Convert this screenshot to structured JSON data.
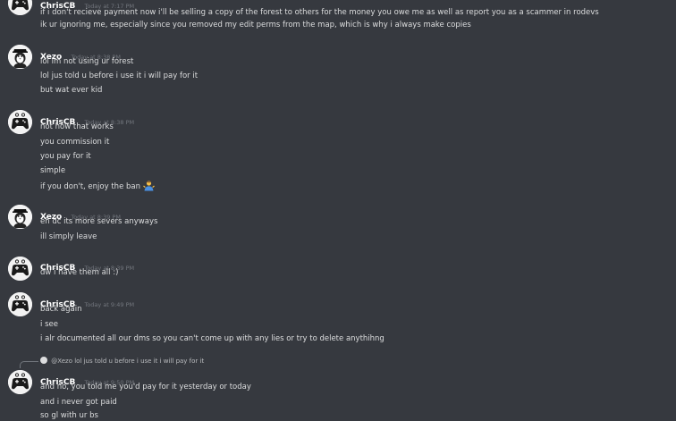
{
  "groups": [
    {
      "author": "ChrisCB",
      "timestamp": "Today at 7:17 PM",
      "avatar": "gamepad-avatar",
      "lines": [
        "if i don't recieve payment now i'll be selling a copy of the forest to others for the money you owe me as well as report you as a scammer in rodevs",
        "ik ur ignoring me, especially since you removed my edit perms from the map, which is why i always make copies"
      ]
    },
    {
      "author": "Xezo",
      "timestamp": "Today at 8:38 PM",
      "avatar": "penguin-avatar",
      "lines": [
        "lol im not using ur forest",
        "lol jus told u before i use it i will pay for it",
        "but wat ever kid"
      ]
    },
    {
      "author": "ChrisCB",
      "timestamp": "Today at 8:38 PM",
      "avatar": "gamepad-avatar",
      "lines": [
        "not how that works",
        "you commission it",
        "you pay for it",
        "simple",
        "if you don't, enjoy the ban"
      ]
    },
    {
      "author": "Xezo",
      "timestamp": "Today at 8:39 PM",
      "avatar": "penguin-avatar",
      "lines": [
        "eh dc its more severs anyways",
        "ill simply leave"
      ]
    },
    {
      "author": "ChrisCB",
      "timestamp": "Today at 8:39 PM",
      "avatar": "gamepad-avatar",
      "lines": [
        "dw i have them all :)"
      ]
    },
    {
      "author": "ChrisCB",
      "timestamp": "Today at 9:49 PM",
      "avatar": "gamepad-avatar",
      "lines": [
        "back again",
        "i see",
        "i alr documented all our dms so you can't come up with any lies or try to delete anythihng"
      ]
    },
    {
      "author": "ChrisCB",
      "timestamp": "Today at 9:50 PM",
      "avatar": "gamepad-avatar",
      "reply": {
        "mention": "@Xezo",
        "text": "lol jus told u before i use it i will pay for it"
      },
      "lines": [
        "and no, you told me you'd pay for it yesterday or today",
        "and i never got paid",
        "so gl with ur bs"
      ]
    }
  ],
  "colors": {
    "background": "#36393f",
    "text": "#dcddde",
    "username": "#ffffff",
    "timestamp": "#72767d"
  }
}
